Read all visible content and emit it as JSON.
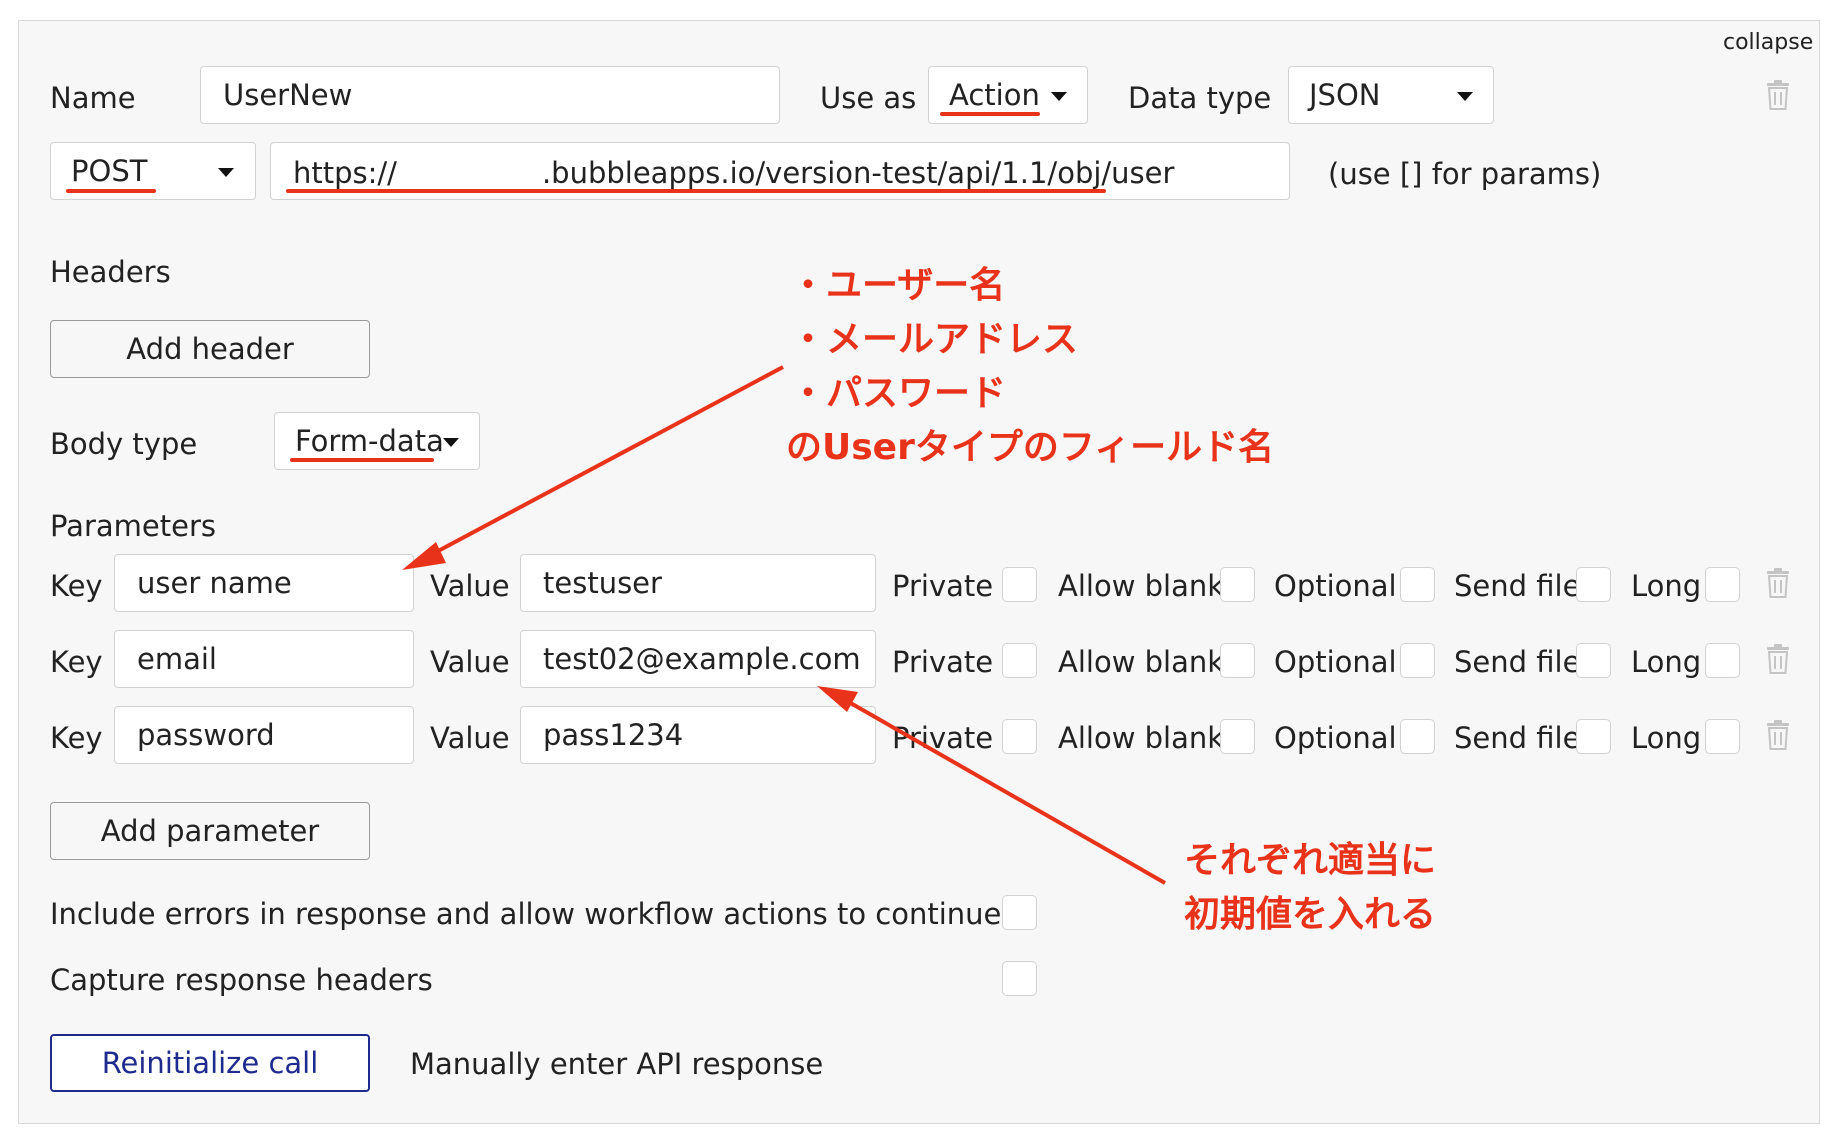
{
  "header": {
    "collapse_label": "collapse",
    "name_label": "Name",
    "name_value": "UserNew",
    "use_as_label": "Use as",
    "use_as_value": "Action",
    "data_type_label": "Data type",
    "data_type_value": "JSON",
    "method_value": "POST",
    "url_value": "https://　　　　　.bubbleapps.io/version-test/api/1.1/obj/user",
    "params_hint": "(use [] for params)"
  },
  "headers_section": {
    "title": "Headers",
    "add_header_label": "Add header"
  },
  "body": {
    "label": "Body type",
    "value": "Form-data"
  },
  "parameters": {
    "title": "Parameters",
    "key_label": "Key",
    "value_label": "Value",
    "rows": [
      {
        "key": "user name",
        "value": "testuser"
      },
      {
        "key": "email",
        "value": "test02@example.com"
      },
      {
        "key": "password",
        "value": "pass1234"
      }
    ],
    "options": [
      "Private",
      "Allow blank",
      "Optional",
      "Send file",
      "Long"
    ],
    "add_parameter_label": "Add parameter"
  },
  "settings": {
    "include_errors_label": "Include errors in response and allow workflow actions to continue",
    "capture_headers_label": "Capture response headers"
  },
  "footer": {
    "reinitialize_label": "Reinitialize call",
    "manual_response_label": "Manually enter API response"
  },
  "annotations": {
    "fields_note": [
      "・ユーザー名",
      "・メールアドレス",
      "・パスワード",
      "のUserタイプのフィールド名"
    ],
    "values_note": [
      "それぞれ適当に",
      "初期値を入れる"
    ]
  },
  "colors": {
    "annotation_red": "#e8331a",
    "primary_button": "#1f2a8f",
    "panel_bg": "#f7f7f7"
  }
}
